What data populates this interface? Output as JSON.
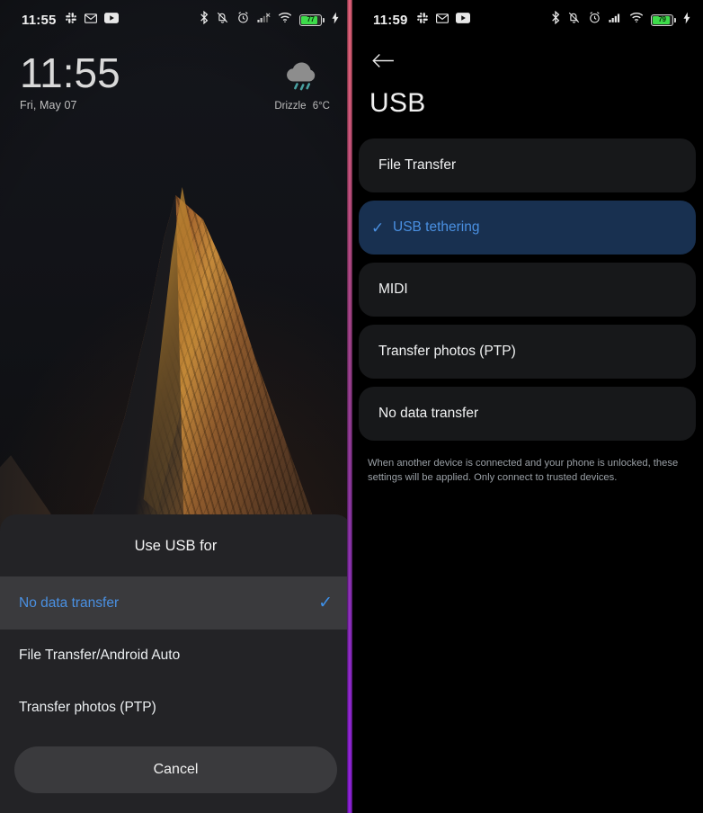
{
  "left_phone": {
    "status_bar": {
      "time": "11:55",
      "left_icons": [
        "slack-icon",
        "gmail-icon",
        "youtube-icon"
      ],
      "right_icons": [
        "bluetooth-icon",
        "vibrate-off-icon",
        "alarm-icon",
        "signal-icon",
        "wifi-icon"
      ],
      "battery_percent": "77",
      "charging": true
    },
    "lock_screen": {
      "clock": "11:55",
      "date": "Fri, May 07",
      "weather": {
        "condition": "Drizzle",
        "temperature": "6°C",
        "icon": "drizzle-icon"
      }
    },
    "usb_sheet": {
      "title": "Use USB for",
      "options": [
        {
          "label": "No data transfer",
          "selected": true
        },
        {
          "label": "File Transfer/Android Auto",
          "selected": false
        },
        {
          "label": "Transfer photos (PTP)",
          "selected": false
        }
      ],
      "cancel_label": "Cancel",
      "accent_color": "#4a90e2"
    }
  },
  "right_phone": {
    "status_bar": {
      "time": "11:59",
      "left_icons": [
        "slack-icon",
        "gmail-icon",
        "youtube-icon"
      ],
      "right_icons": [
        "bluetooth-icon",
        "vibrate-off-icon",
        "alarm-icon",
        "signal-icon",
        "wifi-icon"
      ],
      "battery_percent": "79",
      "charging": true
    },
    "usb_settings": {
      "back_icon": "back-arrow-icon",
      "title": "USB",
      "options": [
        {
          "label": "File Transfer",
          "selected": false
        },
        {
          "label": "USB tethering",
          "selected": true
        },
        {
          "label": "MIDI",
          "selected": false
        },
        {
          "label": "Transfer photos (PTP)",
          "selected": false
        },
        {
          "label": "No data transfer",
          "selected": false
        }
      ],
      "footnote": "When another device is connected and your phone is unlocked, these settings will be applied. Only connect to trusted devices.",
      "accent_color": "#4a90e2",
      "selected_bg": "#183050"
    }
  },
  "divider": {
    "name": "screen-divider",
    "gradient_top": "#e2607a",
    "gradient_bottom": "#8f22dd"
  }
}
